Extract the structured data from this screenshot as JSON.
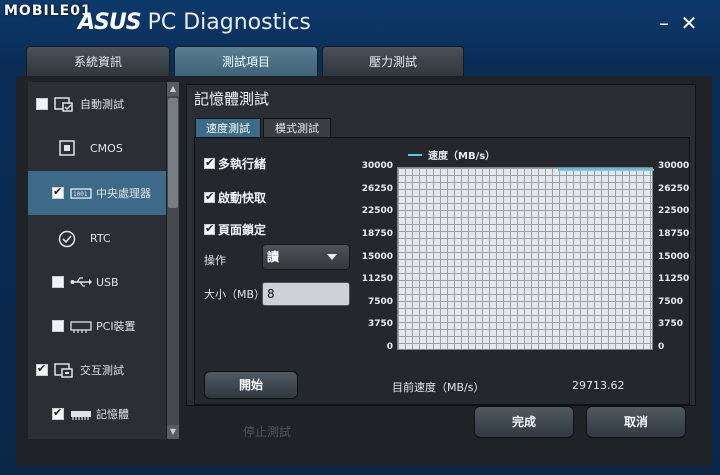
{
  "watermark": "MOBILE01",
  "app": {
    "brand": "ASUS",
    "title": "PC Diagnostics"
  },
  "window_controls": {
    "minimize": "–",
    "close": "✕"
  },
  "tabs": [
    {
      "label": "系統資訊"
    },
    {
      "label": "測試項目"
    },
    {
      "label": "壓力測試"
    }
  ],
  "sidebar": {
    "items": [
      {
        "label": "自動測試",
        "icon": "auto-test-icon",
        "checked": false
      },
      {
        "label": "CMOS",
        "icon": "cmos-icon",
        "checked": null
      },
      {
        "label": "中央處理器",
        "icon": "cpu-icon",
        "checked": true
      },
      {
        "label": "RTC",
        "icon": "rtc-clock-icon",
        "checked": null
      },
      {
        "label": "USB",
        "icon": "usb-icon",
        "checked": false
      },
      {
        "label": "PCI裝置",
        "icon": "pci-icon",
        "checked": false
      },
      {
        "label": "交互測試",
        "icon": "interactive-test-icon",
        "checked": true
      },
      {
        "label": "記憶體",
        "icon": "memory-icon",
        "checked": true
      }
    ]
  },
  "panel": {
    "title": "記憶體測試",
    "subtabs": [
      {
        "label": "速度測試"
      },
      {
        "label": "模式測試"
      }
    ],
    "options": [
      {
        "label": "多執行緒",
        "checked": true
      },
      {
        "label": "啟動快取",
        "checked": true
      },
      {
        "label": "頁面鎖定",
        "checked": true
      }
    ],
    "operation_label": "操作",
    "operation_value": "讀",
    "size_label": "大小（MB）",
    "size_value": "8",
    "start_button": "開始",
    "current_speed_label": "目前速度（MB/s）",
    "current_speed_value": "29713.62"
  },
  "footer": {
    "stop_button": "停止測試",
    "done_button": "完成",
    "cancel_button": "取消"
  },
  "chart_data": {
    "type": "line",
    "legend": [
      "速度（MB/s）"
    ],
    "series": [
      {
        "name": "速度（MB/s）",
        "color": "#57c7e8",
        "values": [
          29713.62
        ]
      }
    ],
    "y_ticks": [
      "30000",
      "26250",
      "22500",
      "18750",
      "15000",
      "11250",
      "7500",
      "3750",
      "0"
    ],
    "ylim": [
      0,
      30000
    ],
    "grid": true
  }
}
